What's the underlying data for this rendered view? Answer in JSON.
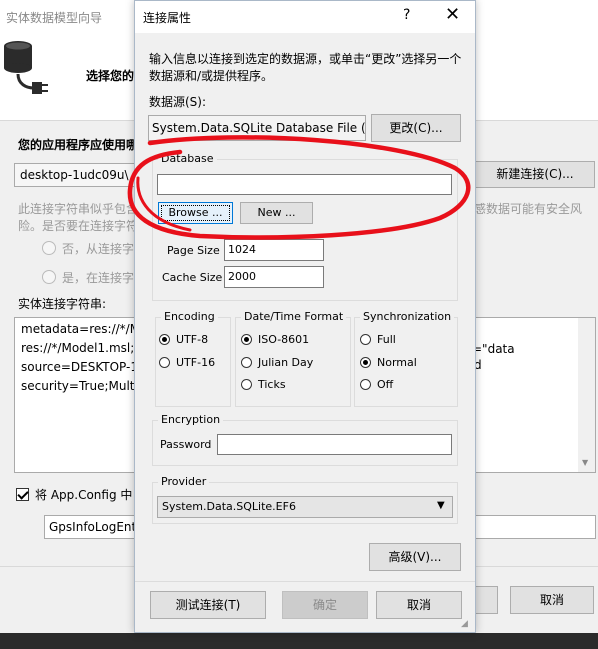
{
  "wizard": {
    "title": "实体数据模型向导",
    "header_text": "选择您的",
    "question_label": "您的应用程序应使用哪",
    "connection_value": "desktop-1udc09u\\",
    "new_connection_button": "新建连接(C)...",
    "warning_line1": "此连接字符串似乎包含",
    "warning_line2": "险。是否要在连接字符",
    "warning_right": "感数据可能有安全风",
    "radio_no": "否，从连接字符",
    "radio_yes": "是，在连接字符",
    "entity_label": "实体连接字符串:",
    "entity_lines": [
      "metadata=res://*/M",
      "res://*/Model1.msl;",
      "source=DESKTOP-1",
      "security=True;Multi"
    ],
    "entity_right_1": "=\"data",
    "entity_right_2": "d",
    "appconfig_label": "将 App.Config 中",
    "appconfig_checked": true,
    "name_value": "GpsInfoLogEnt",
    "cancel_button": "取消"
  },
  "dialog": {
    "title": "连接属性",
    "help_glyph": "?",
    "close_glyph": "✕",
    "instruction_line1": "输入信息以连接到选定的数据源，或单击“更改”选择另一个",
    "instruction_line2": "数据源和/或提供程序。",
    "datasource_label": "数据源(S):",
    "datasource_value": "System.Data.SQLite Database File (.N",
    "change_button": "更改(C)...",
    "database": {
      "group_label": "Database",
      "value": "",
      "browse_button": "Browse ...",
      "new_button": "New ...",
      "page_size_label": "Page Size",
      "page_size_value": "1024",
      "cache_size_label": "Cache Size",
      "cache_size_value": "2000"
    },
    "encoding": {
      "group_label": "Encoding",
      "options": [
        "UTF-8",
        "UTF-16"
      ],
      "selected": "UTF-8"
    },
    "datetime": {
      "group_label": "Date/Time Format",
      "options": [
        "ISO-8601",
        "Julian Day",
        "Ticks"
      ],
      "selected": "ISO-8601"
    },
    "sync": {
      "group_label": "Synchronization",
      "options": [
        "Full",
        "Normal",
        "Off"
      ],
      "selected": "Normal"
    },
    "encryption": {
      "group_label": "Encryption",
      "password_label": "Password",
      "password_value": ""
    },
    "provider": {
      "group_label": "Provider",
      "value": "System.Data.SQLite.EF6"
    },
    "advanced_button": "高级(V)...",
    "test_button": "测试连接(T)",
    "ok_button": "确定",
    "cancel_button": "取消"
  },
  "colors": {
    "annotation_red": "#e8101a",
    "focus_blue": "#0078d7",
    "disabled_text": "#8a8a8a"
  }
}
